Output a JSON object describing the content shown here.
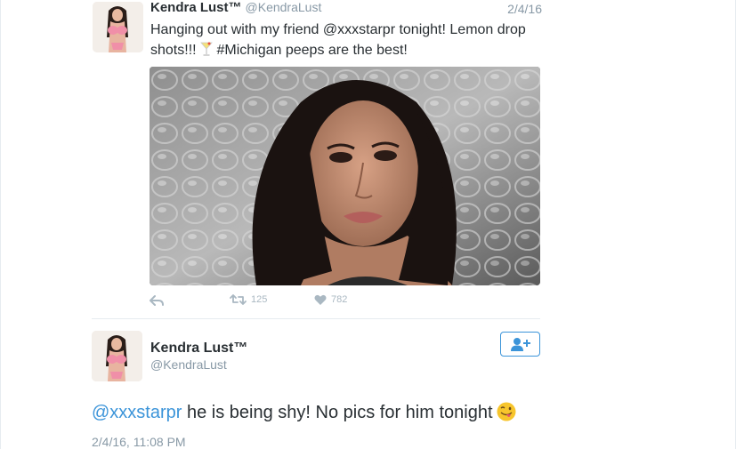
{
  "tweet1": {
    "display_name": "Kendra Lust™",
    "handle": "@KendraLust",
    "date": "2/4/16",
    "text_part1": "Hanging out with my friend @xxxstarpr tonight! Lemon drop shots!!! ",
    "text_part2": " #Michigan peeps are the best!",
    "inline_emoji": "cocktail-glass-icon",
    "media": "photo",
    "retweet_count": "125",
    "like_count": "782"
  },
  "tweet2": {
    "display_name": "Kendra Lust™",
    "handle": "@KendraLust",
    "mention": "@xxxstarpr",
    "text": " he is being shy! No pics for him tonight",
    "emoji": "winking-tongue-face-icon",
    "timestamp": "2/4/16, 11:08 PM"
  },
  "icons": {
    "reply": "reply-icon",
    "retweet": "retweet-icon",
    "like": "heart-icon",
    "follow": "follow-user-icon"
  },
  "colors": {
    "link": "#3b94d9",
    "muted": "#8899a6",
    "action": "#aab8c2",
    "text": "#292f33",
    "divider": "#e6ecf0"
  }
}
